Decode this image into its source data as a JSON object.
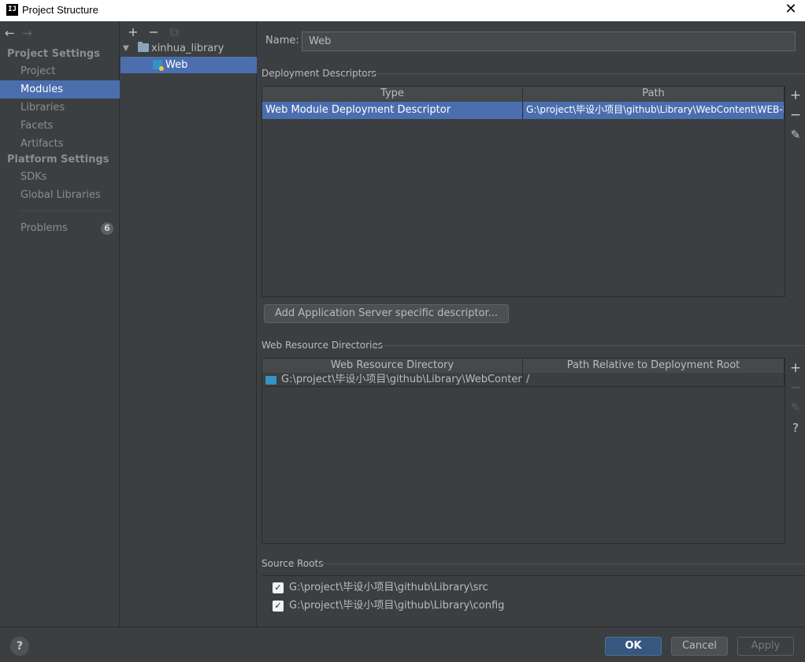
{
  "window": {
    "app_icon": "IJ",
    "title": "Project Structure",
    "close_glyph": "✕"
  },
  "sidebar": {
    "back_glyph": "←",
    "forward_glyph": "→",
    "project_settings_header": "Project Settings",
    "project_settings_items": [
      "Project",
      "Modules",
      "Libraries",
      "Facets",
      "Artifacts"
    ],
    "platform_settings_header": "Platform Settings",
    "platform_settings_items": [
      "SDKs",
      "Global Libraries"
    ],
    "problems_label": "Problems",
    "problems_count": "6",
    "selected_item": "Modules"
  },
  "tree": {
    "tools": [
      "+",
      "−",
      "⧉"
    ],
    "root": "xinhua_library",
    "child": "Web"
  },
  "module": {
    "name_label": "Name:",
    "name_value": "Web"
  },
  "deployment_descriptors": {
    "title": "Deployment Descriptors",
    "columns": [
      "Type",
      "Path"
    ],
    "rows": [
      {
        "type": "Web Module Deployment Descriptor",
        "path": "G:\\project\\毕设小项目\\github\\Library\\WebContent\\WEB-I"
      }
    ],
    "add_button": "Add Application Server specific descriptor..."
  },
  "web_resource_directories": {
    "title": "Web Resource Directories",
    "columns": [
      "Web Resource Directory",
      "Path Relative to Deployment Root"
    ],
    "rows": [
      {
        "directory": "G:\\project\\毕设小项目\\github\\Library\\WebContent",
        "relative": "/"
      }
    ]
  },
  "source_roots": {
    "title": "Source Roots",
    "items": [
      {
        "checked": true,
        "path": "G:\\project\\毕设小项目\\github\\Library\\src"
      },
      {
        "checked": true,
        "path": "G:\\project\\毕设小项目\\github\\Library\\config"
      }
    ]
  },
  "side_tools": {
    "add": "+",
    "remove": "−",
    "edit": "✎",
    "help": "?"
  },
  "footer": {
    "help": "?",
    "ok": "OK",
    "cancel": "Cancel",
    "apply": "Apply"
  },
  "colors": {
    "background": "#3c3f41",
    "selection": "#4b6eaf",
    "ok_button": "#365880"
  }
}
